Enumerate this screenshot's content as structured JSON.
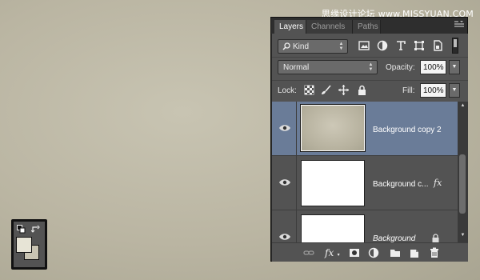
{
  "watermark": "思缘设计论坛 www.MISSYUAN.COM",
  "panel": {
    "tabs": [
      {
        "label": "Layers",
        "active": true
      },
      {
        "label": "Channels",
        "active": false
      },
      {
        "label": "Paths",
        "active": false
      }
    ],
    "menu_icon": "panel-menu-icon",
    "filter": {
      "kind_label": "Kind",
      "icons": [
        "image-filter-icon",
        "adjustment-filter-icon",
        "type-filter-icon",
        "shape-filter-icon",
        "smart-object-filter-icon"
      ]
    },
    "blend": {
      "mode": "Normal",
      "opacity_label": "Opacity:",
      "opacity": "100%"
    },
    "lock": {
      "label": "Lock:",
      "fill_label": "Fill:",
      "fill": "100%"
    },
    "layers": [
      {
        "name": "Background copy 2",
        "selected": true,
        "fx": false,
        "locked": false,
        "italic": false
      },
      {
        "name": "Background c...",
        "selected": false,
        "fx": true,
        "locked": false,
        "italic": false
      },
      {
        "name": "Background",
        "selected": false,
        "fx": false,
        "locked": true,
        "italic": true
      }
    ],
    "fx_glyph": "fx",
    "bottom_fx_label": "fx"
  },
  "colors": {
    "foreground": "#e7e4d6",
    "background": "#c9c4b2",
    "selected_layer": "#6a7c98"
  }
}
